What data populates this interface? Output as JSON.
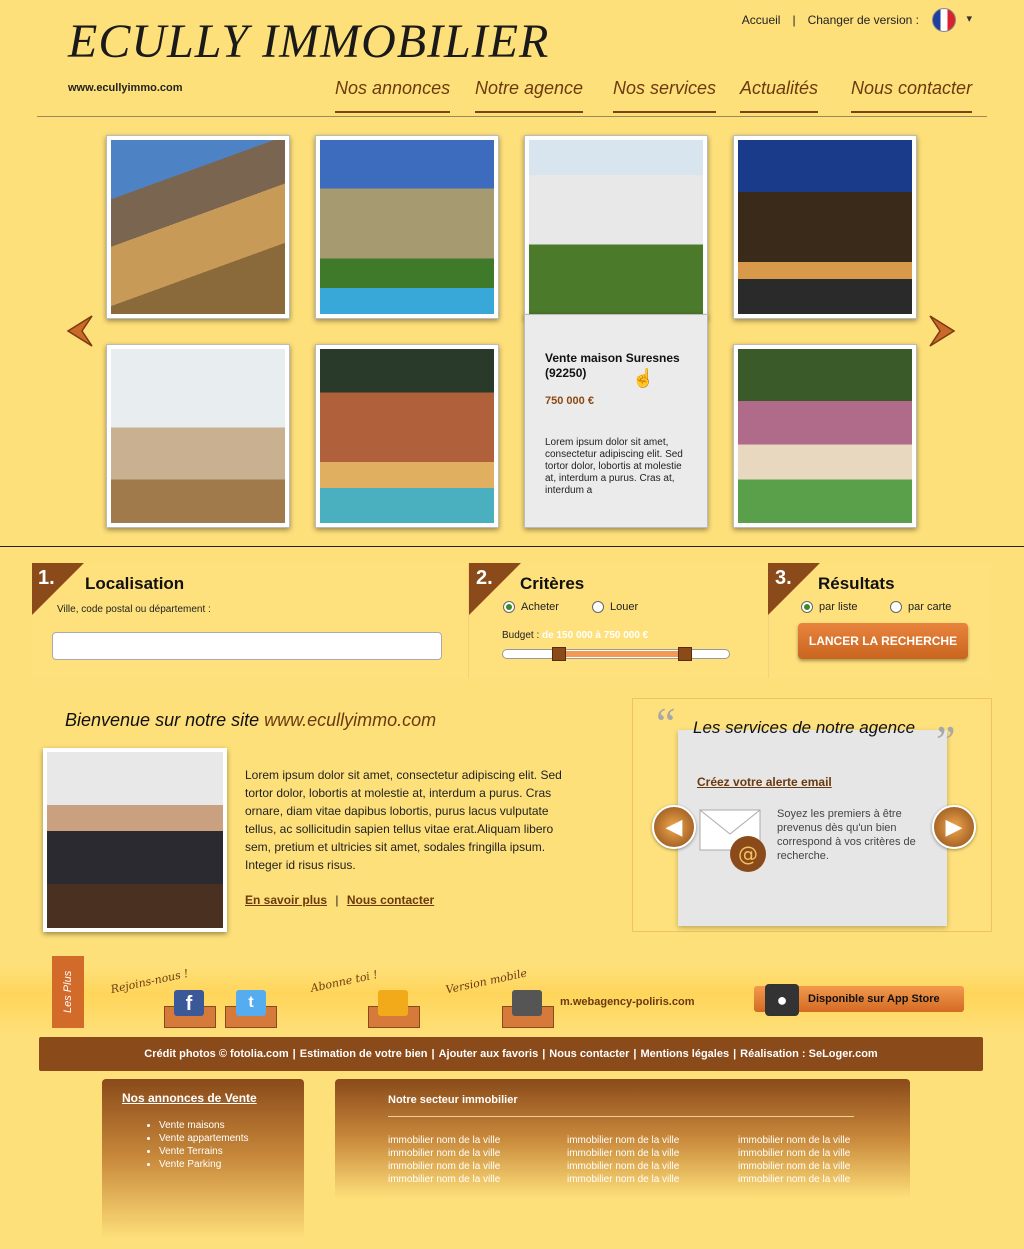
{
  "header": {
    "logo": "ECULLY IMMOBILIER",
    "url": "www.ecullyimmo.com",
    "top_links": {
      "home": "Accueil",
      "sep": "|",
      "version": "Changer de version :"
    }
  },
  "nav": [
    "Nos annonces",
    "Notre agence",
    "Nos services",
    "Actualités",
    "Nous contacter"
  ],
  "gallery": {
    "card": {
      "title": "Vente maison Suresnes (92250)",
      "price": "750 000 €",
      "description": "Lorem ipsum dolor sit amet, consectetur adipiscing elit. Sed tortor dolor, lobortis at molestie at, interdum a purus. Cras at, interdum a"
    }
  },
  "search": {
    "step1": {
      "num": "1.",
      "title": "Localisation",
      "label": "Ville, code postal ou département :"
    },
    "step2": {
      "num": "2.",
      "title": "Critères",
      "opt_buy": "Acheter",
      "opt_rent": "Louer",
      "budget_label": "Budget :",
      "budget_range": "de 150 000 à 750 000 €"
    },
    "step3": {
      "num": "3.",
      "title": "Résultats",
      "opt_list": "par liste",
      "opt_map": "par carte",
      "button": "LANCER LA RECHERCHE"
    }
  },
  "welcome": {
    "title": "Bienvenue sur notre site ",
    "title_url": "www.ecullyimmo.com",
    "text": "Lorem ipsum dolor sit amet, consectetur adipiscing elit. Sed tortor dolor, lobortis at molestie at, interdum a purus. Cras ornare, diam vitae dapibus lobortis, purus lacus vulputate tellus, ac sollicitudin sapien tellus vitae erat.Aliquam libero sem, pretium et ultricies sit amet, sodales fringilla ipsum. Integer id risus risus.",
    "link_more": "En savoir plus",
    "sep": "|",
    "link_contact": "Nous contacter"
  },
  "services": {
    "title": "Les services de notre agence",
    "link": "Créez votre alerte email",
    "text": "Soyez les premiers à être prevenus dès qu'un bien correspond à vos critères de recherche."
  },
  "social": {
    "lesplus": "Les Plus",
    "join": "Rejoins-nous !",
    "subscribe": "Abonne toi !",
    "mobile": "Version mobile",
    "mobile_url": "m.webagency-poliris.com",
    "appstore": "Disponible sur App Store"
  },
  "footer": {
    "links": [
      "Crédit photos © fotolia.com",
      "Estimation de votre bien",
      "Ajouter aux favoris",
      "Nous contacter",
      "Mentions légales",
      "Réalisation : SeLoger.com"
    ],
    "sales_title": "Nos annonces de Vente",
    "sales_items": [
      "Vente maisons",
      "Vente appartements",
      "Vente Terrains",
      "Vente Parking"
    ],
    "sector_title": "Notre secteur immobilier",
    "sector_item": "immobilier nom de la ville"
  },
  "colors": {
    "background": "#fee07a",
    "brand_brown": "#8a4a1a",
    "accent_orange": "#d8702e"
  }
}
